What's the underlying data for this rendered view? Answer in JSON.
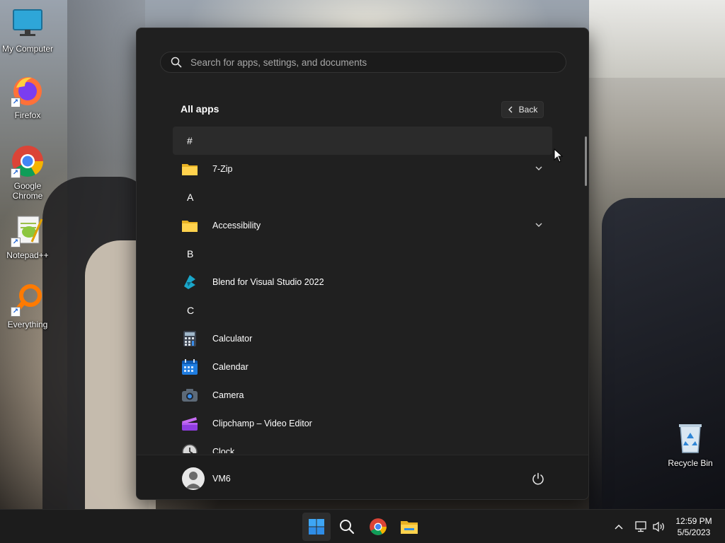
{
  "desktop": {
    "icons": [
      {
        "label": "My Computer"
      },
      {
        "label": "Firefox"
      },
      {
        "label": "Google Chrome"
      },
      {
        "label": "Notepad++"
      },
      {
        "label": "Everything"
      },
      {
        "label": "Recycle Bin"
      }
    ]
  },
  "start_menu": {
    "search_placeholder": "Search for apps, settings, and documents",
    "all_apps_title": "All apps",
    "back_label": "Back",
    "list": [
      {
        "kind": "letter",
        "label": "#",
        "active": true
      },
      {
        "kind": "app",
        "label": "7-Zip",
        "icon": "folder-icon",
        "expandable": true
      },
      {
        "kind": "letter",
        "label": "A"
      },
      {
        "kind": "app",
        "label": "Accessibility",
        "icon": "folder-icon",
        "expandable": true
      },
      {
        "kind": "letter",
        "label": "B"
      },
      {
        "kind": "app",
        "label": "Blend for Visual Studio 2022",
        "icon": "blend-icon"
      },
      {
        "kind": "letter",
        "label": "C"
      },
      {
        "kind": "app",
        "label": "Calculator",
        "icon": "calculator-icon"
      },
      {
        "kind": "app",
        "label": "Calendar",
        "icon": "calendar-icon"
      },
      {
        "kind": "app",
        "label": "Camera",
        "icon": "camera-icon"
      },
      {
        "kind": "app",
        "label": "Clipchamp – Video Editor",
        "icon": "clipchamp-icon"
      },
      {
        "kind": "app",
        "label": "Clock",
        "icon": "clock-icon"
      }
    ],
    "user_name": "VM6"
  },
  "taskbar": {
    "pinned": [
      "start-icon",
      "search-icon",
      "chrome-icon",
      "file-explorer-icon"
    ],
    "clock_time": "12:59 PM",
    "clock_date": "5/5/2023"
  },
  "colors": {
    "menu_bg": "#202020",
    "taskbar_bg": "#1c1c1c",
    "accent": "#3b8eea"
  }
}
